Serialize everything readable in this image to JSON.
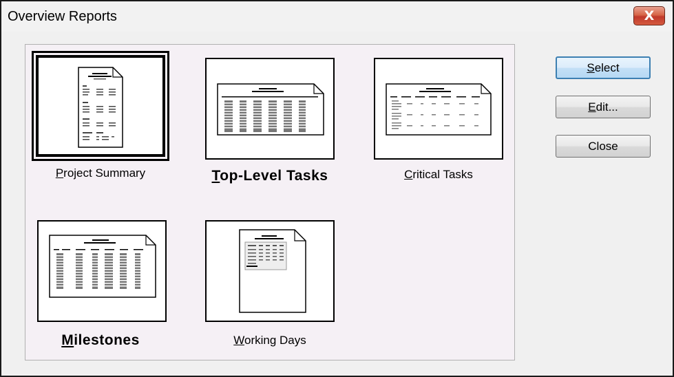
{
  "window": {
    "title": "Overview Reports",
    "close_glyph": "X"
  },
  "reports": [
    {
      "label_first": "P",
      "label_rest": "roject Summary",
      "selected": true,
      "icon": "project-summary-report-icon"
    },
    {
      "label_first": "T",
      "label_rest": "op-Level Tasks",
      "selected": false,
      "icon": "top-level-tasks-report-icon"
    },
    {
      "label_first": "C",
      "label_rest": "ritical Tasks",
      "selected": false,
      "icon": "critical-tasks-report-icon"
    },
    {
      "label_first": "M",
      "label_rest": "ilestones",
      "selected": false,
      "icon": "milestones-report-icon"
    },
    {
      "label_first": "W",
      "label_rest": "orking Days",
      "selected": false,
      "icon": "working-days-report-icon"
    }
  ],
  "buttons": {
    "select_first": "S",
    "select_rest": "elect",
    "edit_first": "E",
    "edit_rest": "dit...",
    "close": "Close"
  }
}
